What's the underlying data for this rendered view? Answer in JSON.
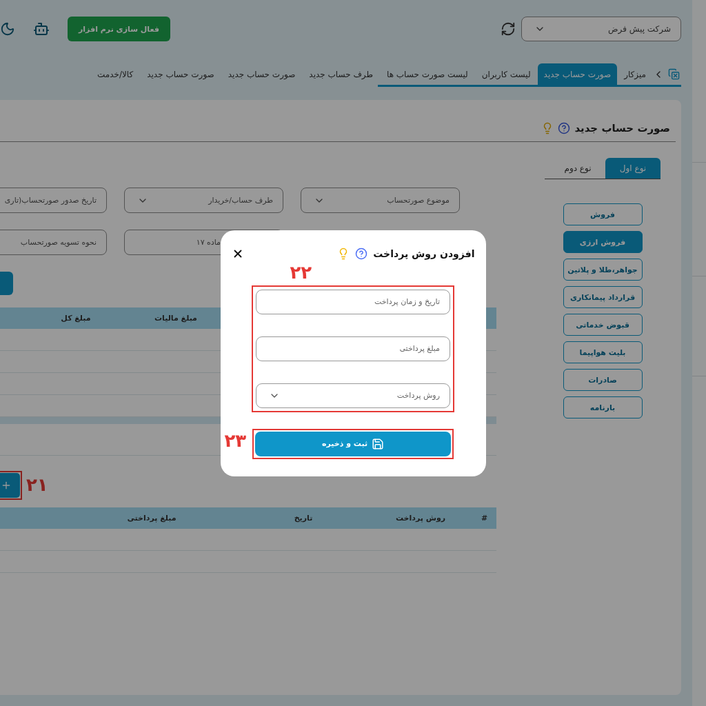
{
  "header": {
    "company_select": {
      "value": "شرکت پیش فرض"
    },
    "activate_button": "فعال سازی نرم افزار"
  },
  "tabs": [
    {
      "label": "میزکار",
      "selected": false
    },
    {
      "label": "صورت حساب جدید",
      "selected": true
    },
    {
      "label": "لیست کاربران",
      "selected": false
    },
    {
      "label": "لیست صورت حساب ها",
      "selected": false
    },
    {
      "label": "طرف حساب جدید",
      "selected": false
    },
    {
      "label": "صورت حساب جدید",
      "selected": false
    },
    {
      "label": "صورت حساب جدید",
      "selected": false
    },
    {
      "label": "کالا/خدمت",
      "selected": false
    }
  ],
  "page": {
    "title": "صورت حساب جدید"
  },
  "type_tabs": [
    {
      "label": "نوع اول",
      "selected": true
    },
    {
      "label": "نوع دوم",
      "selected": false
    }
  ],
  "categories": [
    {
      "label": "فروش",
      "selected": false
    },
    {
      "label": "فروش ارزی",
      "selected": true
    },
    {
      "label": "جواهر،طلا و پلاتین",
      "selected": false
    },
    {
      "label": "قرارداد پیمانکاری",
      "selected": false
    },
    {
      "label": "قبوض خدماتی",
      "selected": false
    },
    {
      "label": "بلیت هواپیما",
      "selected": false
    },
    {
      "label": "صادرات",
      "selected": false
    },
    {
      "label": "بارنامه",
      "selected": false
    }
  ],
  "form_row_1": [
    {
      "kind": "select",
      "placeholder": "موضوع صورتحساب"
    },
    {
      "kind": "select",
      "placeholder": "طرف حساب/خریدار"
    },
    {
      "kind": "input",
      "placeholder": "تاریخ صدور صورتحساب(تاری"
    }
  ],
  "form_row_2": [
    {
      "placeholder": "ماده ۱۷"
    },
    {
      "placeholder": "نحوه تسویه صورتحساب"
    }
  ],
  "items_table": {
    "columns": [
      "مبلغ مالیات",
      "مبلغ کل"
    ]
  },
  "add_payment": {
    "annotation": "۲۱"
  },
  "payments_table": {
    "columns": [
      "#",
      "روش پرداخت",
      "تاریخ",
      "مبلغ پرداختی"
    ]
  },
  "modal": {
    "title": "افزودن روش پرداخت",
    "fields": [
      {
        "kind": "input",
        "placeholder": "تاریخ و زمان پرداخت"
      },
      {
        "kind": "input",
        "placeholder": "مبلغ پرداختی"
      },
      {
        "kind": "select",
        "placeholder": "روش پرداخت"
      }
    ],
    "fields_annotation": "۲۲",
    "save_button": "ثبت و ذخیره",
    "save_annotation": "۲۳"
  }
}
